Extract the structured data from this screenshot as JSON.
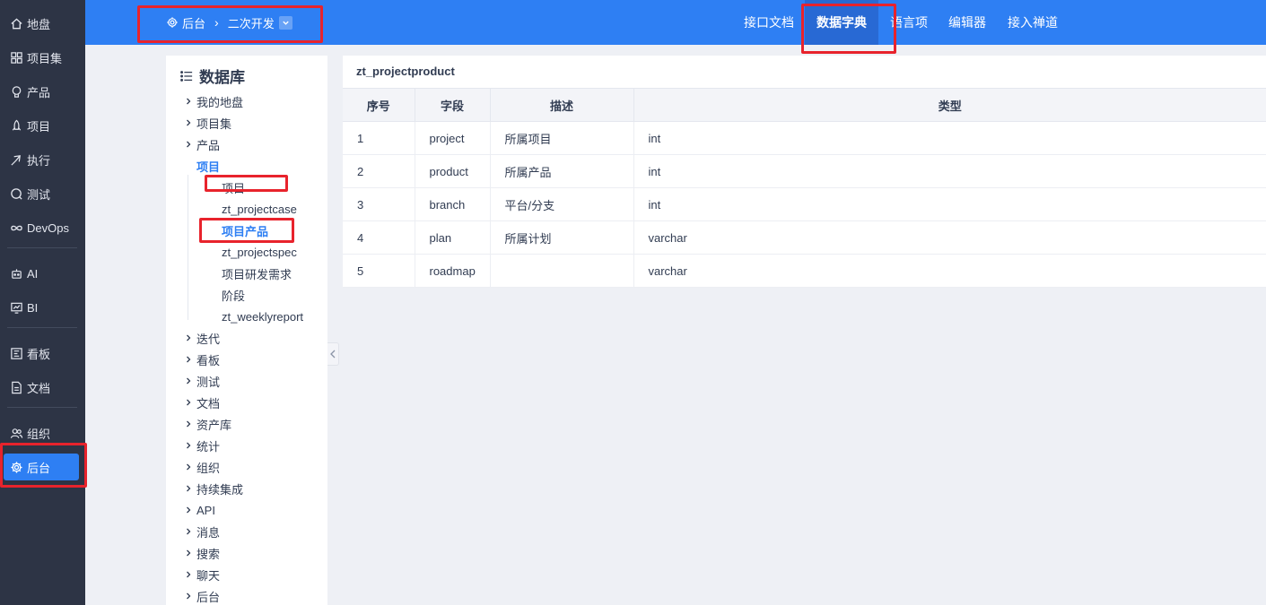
{
  "leftnav": {
    "items": [
      {
        "label": "地盘"
      },
      {
        "label": "项目集"
      },
      {
        "label": "产品"
      },
      {
        "label": "项目"
      },
      {
        "label": "执行"
      },
      {
        "label": "测试"
      },
      {
        "label": "DevOps"
      },
      {
        "label": "AI"
      },
      {
        "label": "BI"
      },
      {
        "label": "看板"
      },
      {
        "label": "文档"
      },
      {
        "label": "组织"
      },
      {
        "label": "后台"
      }
    ],
    "active": "后台"
  },
  "breadcrumb": {
    "root": "后台",
    "current": "二次开发"
  },
  "topnav": {
    "items": [
      {
        "label": "接口文档"
      },
      {
        "label": "数据字典"
      },
      {
        "label": "语言项"
      },
      {
        "label": "编辑器"
      },
      {
        "label": "接入禅道"
      }
    ],
    "active": "数据字典"
  },
  "tree": {
    "title": "数据库",
    "nodes_before": [
      "我的地盘",
      "项目集",
      "产品"
    ],
    "open_node": "项目",
    "children": [
      "项目",
      "zt_projectcase",
      "项目产品",
      "zt_projectspec",
      "项目研发需求",
      "阶段",
      "zt_weeklyreport"
    ],
    "active_child": "项目产品",
    "nodes_after": [
      "迭代",
      "看板",
      "测试",
      "文档",
      "资产库",
      "统计",
      "组织",
      "持续集成",
      "API",
      "消息",
      "搜索",
      "聊天",
      "后台"
    ]
  },
  "table": {
    "title": "zt_projectproduct",
    "headers": [
      "序号",
      "字段",
      "描述",
      "类型"
    ],
    "rows": [
      [
        "1",
        "project",
        "所属项目",
        "int"
      ],
      [
        "2",
        "product",
        "所属产品",
        "int"
      ],
      [
        "3",
        "branch",
        "平台/分支",
        "int"
      ],
      [
        "4",
        "plan",
        "所属计划",
        "varchar"
      ],
      [
        "5",
        "roadmap",
        "",
        "varchar"
      ]
    ]
  },
  "colors": {
    "primary": "#2e7ff3",
    "sidebar": "#2d3445",
    "annotation": "#e8232c"
  }
}
